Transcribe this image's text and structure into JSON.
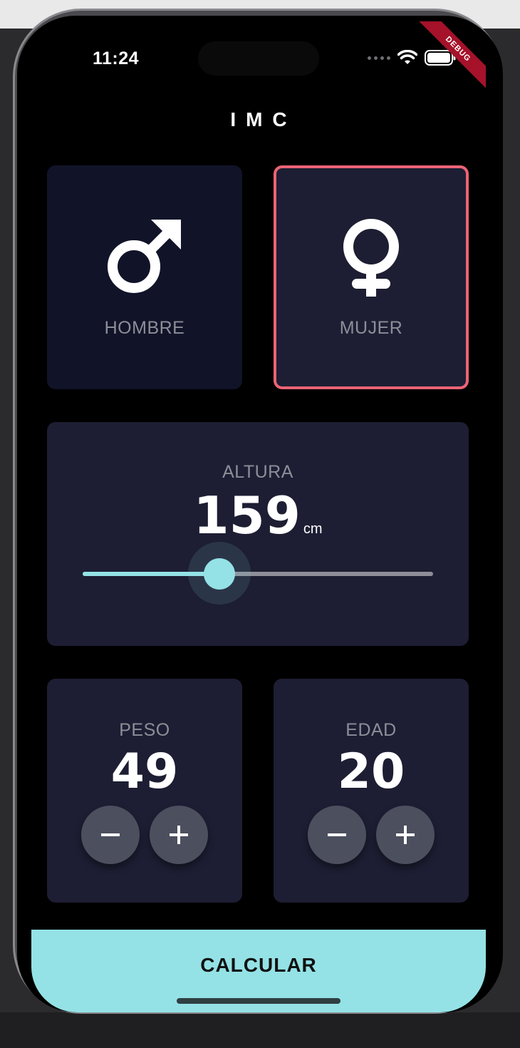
{
  "status_bar": {
    "time": "11:24",
    "debug_banner": "DEBUG"
  },
  "app": {
    "title": "IMC"
  },
  "gender": {
    "male": {
      "label": "HOMBRE",
      "icon": "male-symbol-icon",
      "selected": false
    },
    "female": {
      "label": "MUJER",
      "icon": "female-symbol-icon",
      "selected": true
    }
  },
  "height": {
    "label": "ALTURA",
    "value": "159",
    "unit": "cm",
    "slider_fraction": 0.39
  },
  "weight": {
    "label": "PESO",
    "value": "49",
    "decrement_icon": "minus-icon",
    "increment_icon": "plus-icon"
  },
  "age": {
    "label": "EDAD",
    "value": "20",
    "decrement_icon": "minus-icon",
    "increment_icon": "plus-icon"
  },
  "calculate": {
    "label": "CALCULAR"
  },
  "colors": {
    "background": "#000000",
    "card_active": "#1d1e33",
    "card_inactive": "#111328",
    "selected_border": "#eb6375",
    "accent": "#94e2e6",
    "label_gray": "#8d8e98",
    "round_button": "#4c4f5e"
  }
}
